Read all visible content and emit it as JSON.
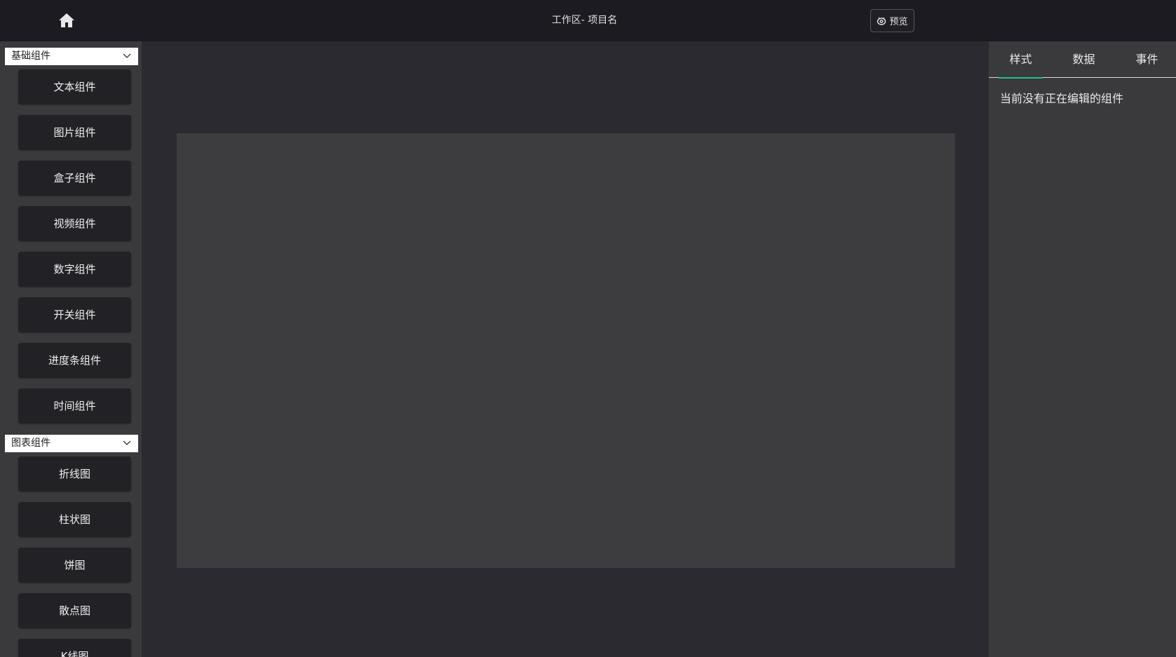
{
  "topbar": {
    "title": "工作区- 项目名",
    "preview_label": "预览",
    "home_icon": "home-icon",
    "preview_icon": "eye-icon"
  },
  "sidebar": {
    "groups": [
      {
        "label": "基础组件",
        "items": [
          "文本组件",
          "图片组件",
          "盒子组件",
          "视频组件",
          "数字组件",
          "开关组件",
          "进度条组件",
          "时间组件"
        ]
      },
      {
        "label": "图表组件",
        "items": [
          "折线图",
          "柱状图",
          "饼图",
          "散点图",
          "K线图"
        ]
      }
    ]
  },
  "rightpanel": {
    "tabs": [
      "样式",
      "数据",
      "事件"
    ],
    "active_tab": "样式",
    "empty_message": "当前没有正在编辑的组件"
  },
  "colors": {
    "topbar_bg": "#1b1b21",
    "panel_bg": "#3a3a3c",
    "workspace_bg": "#2a2a30",
    "canvas_bg": "#3d3c3e",
    "button_bg": "#222226",
    "tab_accent": "#1fbf8f"
  }
}
